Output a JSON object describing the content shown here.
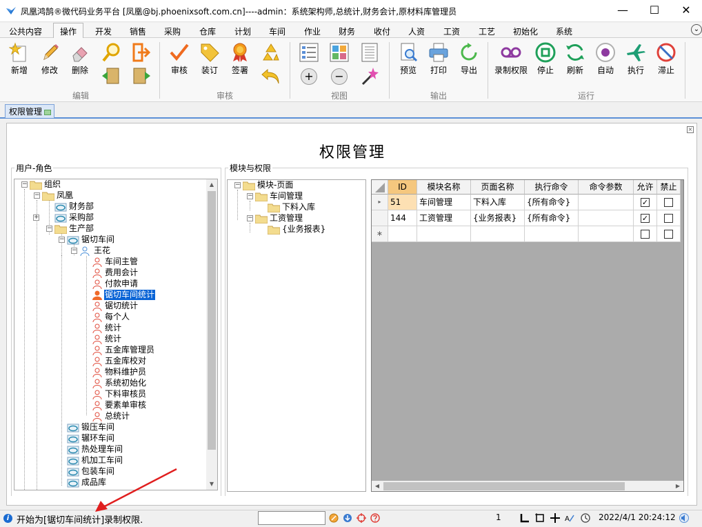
{
  "window": {
    "title": "凤凰鸿鹄®微代码业务平台 [凤凰@bj.phoenixsoft.com.cn]----admin：系统架构师,总统计,财务会计,原材料库管理员",
    "min_symbol": "—",
    "max_symbol": "☐",
    "close_symbol": "✕"
  },
  "menu": {
    "items": [
      "公共内容",
      "操作",
      "开发",
      "销售",
      "采购",
      "仓库",
      "计划",
      "车间",
      "作业",
      "财务",
      "收付",
      "人资",
      "工资",
      "工艺",
      "初始化",
      "系统"
    ],
    "expand_symbol": "⌄"
  },
  "ribbon": {
    "buttons": {
      "new": "新增",
      "edit": "修改",
      "delete": "删除",
      "review": "审核",
      "bind": "装订",
      "sign": "签署",
      "preview": "预览",
      "print": "打印",
      "export": "导出",
      "record_perm": "录制权限",
      "stop": "停止",
      "refresh": "刷新",
      "auto": "自动",
      "execute": "执行",
      "stagnate": "滞止"
    },
    "groups": {
      "edit": "编辑",
      "review": "审核",
      "view": "视图",
      "output": "输出",
      "run": "运行"
    },
    "zoom_in_symbol": "+",
    "zoom_out_symbol": "−"
  },
  "doc_tab": {
    "label": "权限管理"
  },
  "page": {
    "title": "权限管理",
    "close_symbol": "×"
  },
  "user_role": {
    "group_label": "用户-角色",
    "tree": [
      {
        "label": "组织"
      },
      {
        "label": "凤凰"
      },
      {
        "label": "财务部"
      },
      {
        "label": "采购部"
      },
      {
        "label": "生产部"
      },
      {
        "label": "锯切车间"
      },
      {
        "label": "王花"
      },
      {
        "label": "车间主管"
      },
      {
        "label": "费用会计"
      },
      {
        "label": "付款申请"
      },
      {
        "label": "锯切车间统计"
      },
      {
        "label": "锯切统计"
      },
      {
        "label": "每个人"
      },
      {
        "label": "统计"
      },
      {
        "label": "统计"
      },
      {
        "label": "五金库管理员"
      },
      {
        "label": "五金库校对"
      },
      {
        "label": "物料维护员"
      },
      {
        "label": "系统初始化"
      },
      {
        "label": "下料审核员"
      },
      {
        "label": "要素单审核"
      },
      {
        "label": "总统计"
      },
      {
        "label": "锻压车间"
      },
      {
        "label": "辗环车间"
      },
      {
        "label": "热处理车间"
      },
      {
        "label": "机加工车间"
      },
      {
        "label": "包装车间"
      },
      {
        "label": "成品库"
      }
    ],
    "expand_symbols": {
      "minus": "−",
      "plus": "+"
    }
  },
  "module_perm": {
    "group_label": "模块与权限",
    "tree": [
      {
        "label": "模块-页面"
      },
      {
        "label": "车间管理"
      },
      {
        "label": "下料入库"
      },
      {
        "label": "工资管理"
      },
      {
        "label": "{业务报表}"
      }
    ],
    "grid": {
      "columns": [
        "ID",
        "模块名称",
        "页面名称",
        "执行命令",
        "命令参数",
        "允许",
        "禁止"
      ],
      "rows": [
        {
          "id": "51",
          "module": "车间管理",
          "page": "下料入库",
          "cmd": "{所有命令}",
          "param": "",
          "allow": true,
          "deny": false
        },
        {
          "id": "144",
          "module": "工资管理",
          "page": "{业务报表}",
          "cmd": "{所有命令}",
          "param": "",
          "allow": true,
          "deny": false
        }
      ],
      "current_row_symbol": "▸",
      "new_row_symbol": "∗",
      "check_symbol": "✓"
    }
  },
  "status": {
    "message": "开始为[锯切车间统计]录制权限.",
    "page": "1",
    "datetime": "2022/4/1 20:24:12"
  },
  "scroll": {
    "up": "▲",
    "down": "▼",
    "left": "◀",
    "right": "▶"
  }
}
